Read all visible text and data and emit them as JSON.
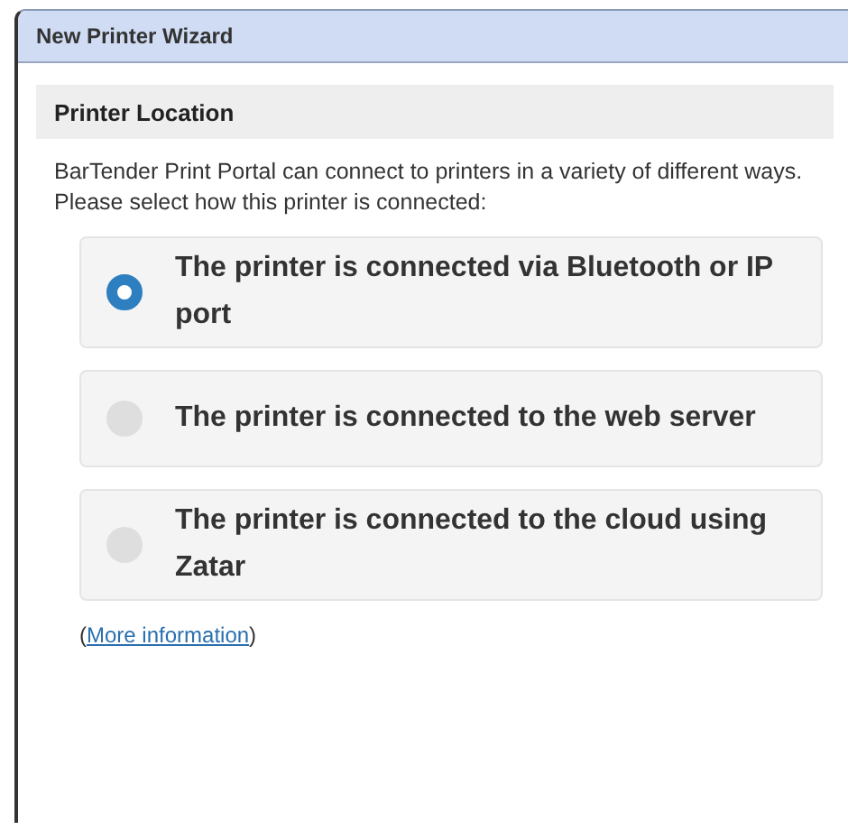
{
  "window": {
    "title": "New Printer Wizard"
  },
  "section": {
    "title": "Printer Location"
  },
  "description": "BarTender Print Portal can connect to printers in a variety of different ways. Please select how this printer is connected:",
  "options": [
    {
      "label": "The printer is connected via Bluetooth or IP port",
      "selected": true
    },
    {
      "label": "The printer is connected to the web server",
      "selected": false
    },
    {
      "label": "The printer is connected to the cloud using Zatar",
      "selected": false
    }
  ],
  "more_info": {
    "before": "(",
    "link": "More information",
    "after": ")"
  }
}
